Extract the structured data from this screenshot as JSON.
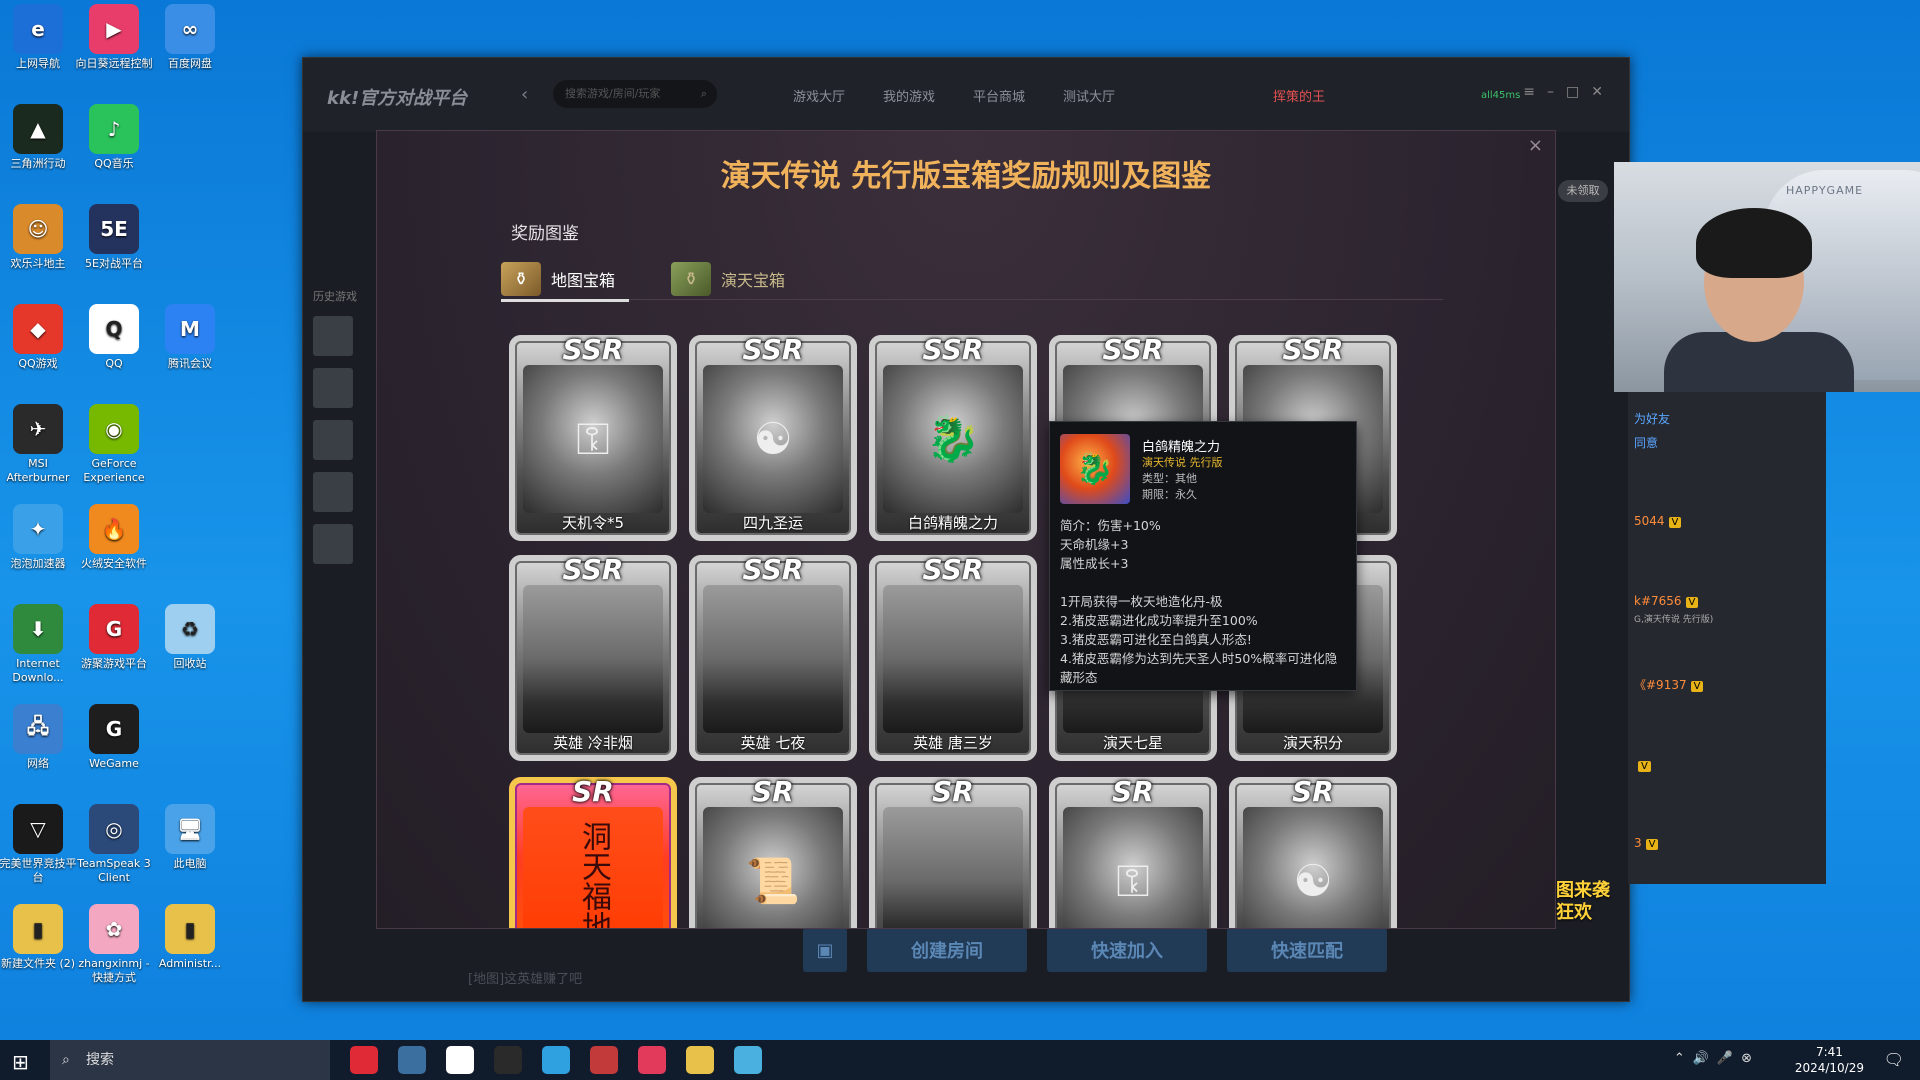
{
  "desktop": {
    "icons": [
      {
        "label": "上网导航",
        "glyph": "e",
        "color": "#1d6fd8"
      },
      {
        "label": "向日葵远程控制",
        "glyph": "▶",
        "color": "#e83d6b"
      },
      {
        "label": "百度网盘",
        "glyph": "∞",
        "color": "#3a8ee6"
      },
      {
        "label": "三角洲行动",
        "glyph": "▲",
        "color": "#1b2a1f"
      },
      {
        "label": "QQ音乐",
        "glyph": "♪",
        "color": "#29c25b"
      },
      {
        "label": "欢乐斗地主",
        "glyph": "☺",
        "color": "#d98a2b"
      },
      {
        "label": "5E对战平台",
        "glyph": "5E",
        "color": "#24325e"
      },
      {
        "label": "QQ游戏",
        "glyph": "◆",
        "color": "#e6372b"
      },
      {
        "label": "QQ",
        "glyph": "Q",
        "color": "#ffffff"
      },
      {
        "label": "腾讯会议",
        "glyph": "M",
        "color": "#2c82f2"
      },
      {
        "label": "MSI Afterburner",
        "glyph": "✈",
        "color": "#2a2a2a"
      },
      {
        "label": "GeForce Experience",
        "glyph": "◉",
        "color": "#76b900"
      },
      {
        "label": "泡泡加速器",
        "glyph": "✦",
        "color": "#3aa0e8"
      },
      {
        "label": "火绒安全软件",
        "glyph": "🔥",
        "color": "#f08a1f"
      },
      {
        "label": "Internet Downlo...",
        "glyph": "⬇",
        "color": "#2f8a3d"
      },
      {
        "label": "游聚游戏平台",
        "glyph": "G",
        "color": "#e02a36"
      },
      {
        "label": "回收站",
        "glyph": "♻",
        "color": "#9ecff0"
      },
      {
        "label": "网络",
        "glyph": "🖧",
        "color": "#3a7fd0"
      },
      {
        "label": "WeGame",
        "glyph": "G",
        "color": "#1e1e1e"
      },
      {
        "label": "完美世界竞技平台",
        "glyph": "▽",
        "color": "#1a1a1a"
      },
      {
        "label": "TeamSpeak 3 Client",
        "glyph": "◎",
        "color": "#2b4a7a"
      },
      {
        "label": "此电脑",
        "glyph": "🖥",
        "color": "#4aa2e8"
      },
      {
        "label": "新建文件夹 (2)",
        "glyph": "▮",
        "color": "#e8c14a"
      },
      {
        "label": "zhangxinmj - 快捷方式",
        "glyph": "✿",
        "color": "#f3a7c0"
      },
      {
        "label": "Administr...",
        "glyph": "▮",
        "color": "#e8c14a"
      }
    ]
  },
  "app": {
    "logo": "kk!官方对战平台",
    "search_placeholder": "搜索游戏/房间/玩家",
    "nav": [
      "游戏大厅",
      "我的游戏",
      "平台商城",
      "测试大厅"
    ],
    "user": "挥策的王",
    "ping": "all45ms",
    "history_label": "历史游戏",
    "bottom_buttons": [
      "创建房间",
      "快速加入",
      "快速匹配"
    ],
    "bottom_hint": "[地图]这英雄赚了吧",
    "claim_label": "未领取"
  },
  "modal": {
    "title": "演天传说 先行版宝箱奖励规则及图鉴",
    "section_title": "奖励图鉴",
    "tabs": [
      {
        "label": "地图宝箱",
        "active": true
      },
      {
        "label": "演天宝箱",
        "active": false
      }
    ],
    "cards": [
      {
        "rarity": "SSR",
        "name": "天机令*5",
        "glyph": "⚿",
        "style": "item"
      },
      {
        "rarity": "SSR",
        "name": "四九圣运",
        "glyph": "☯",
        "style": "item"
      },
      {
        "rarity": "SSR",
        "name": "白鸽精魄之力",
        "glyph": "🐉",
        "style": "item"
      },
      {
        "rarity": "SSR",
        "name": "",
        "glyph": "❖",
        "style": "item"
      },
      {
        "rarity": "SSR",
        "name": "",
        "glyph": "▦",
        "style": "item"
      },
      {
        "rarity": "SSR",
        "name": "英雄 冷非烟",
        "glyph": "",
        "style": "map"
      },
      {
        "rarity": "SSR",
        "name": "英雄 七夜",
        "glyph": "",
        "style": "map"
      },
      {
        "rarity": "SSR",
        "name": "英雄 唐三岁",
        "glyph": "",
        "style": "map"
      },
      {
        "rarity": "SSR",
        "name": "演天七星",
        "glyph": "",
        "style": "map"
      },
      {
        "rarity": "SSR",
        "name": "演天积分",
        "glyph": "",
        "style": "map"
      },
      {
        "rarity": "SR",
        "name": "",
        "glyph": "洞天福地",
        "style": "red"
      },
      {
        "rarity": "SR",
        "name": "",
        "glyph": "📜",
        "style": "item"
      },
      {
        "rarity": "SR",
        "name": "",
        "glyph": "",
        "style": "map"
      },
      {
        "rarity": "SR",
        "name": "",
        "glyph": "⚿",
        "style": "item"
      },
      {
        "rarity": "SR",
        "name": "",
        "glyph": "☯",
        "style": "item"
      }
    ],
    "tooltip": {
      "name": "白鸽精魄之力",
      "game": "演天传说 先行版",
      "type": "类型：其他",
      "term": "期限：永久",
      "lines": [
        "简介：伤害+10%",
        "天命机缘+3",
        "属性成长+3",
        "",
        "1开局获得一枚天地造化丹-极",
        "2.猪皮恶霸进化成功率提升至100%",
        "3.猪皮恶霸可进化至白鸽真人形态!",
        "4.猪皮恶霸修为达到先天圣人时50%概率可进化隐藏形态"
      ]
    }
  },
  "side_panel": {
    "friend_label": "为好友",
    "agree_label": "同意",
    "entries": [
      {
        "text": "5044"
      },
      {
        "text": "k#7656",
        "sub": "G,演天传说 先行版)"
      },
      {
        "text": "《#9137"
      },
      {
        "text": ""
      },
      {
        "text": "3"
      }
    ],
    "promo": "图来袭 狂欢"
  },
  "webcam": {
    "brand": "HAPPYGAME"
  },
  "taskbar": {
    "search_label": "搜索",
    "time": "7:41",
    "date": "2024/10/29",
    "pinned_colors": [
      "#e02a36",
      "#3a6fa0",
      "#ffffff",
      "#2a2a2a",
      "#2fa0e0",
      "#c23a3a",
      "#e23a5a",
      "#e8c14a",
      "#4ab0e0"
    ]
  }
}
